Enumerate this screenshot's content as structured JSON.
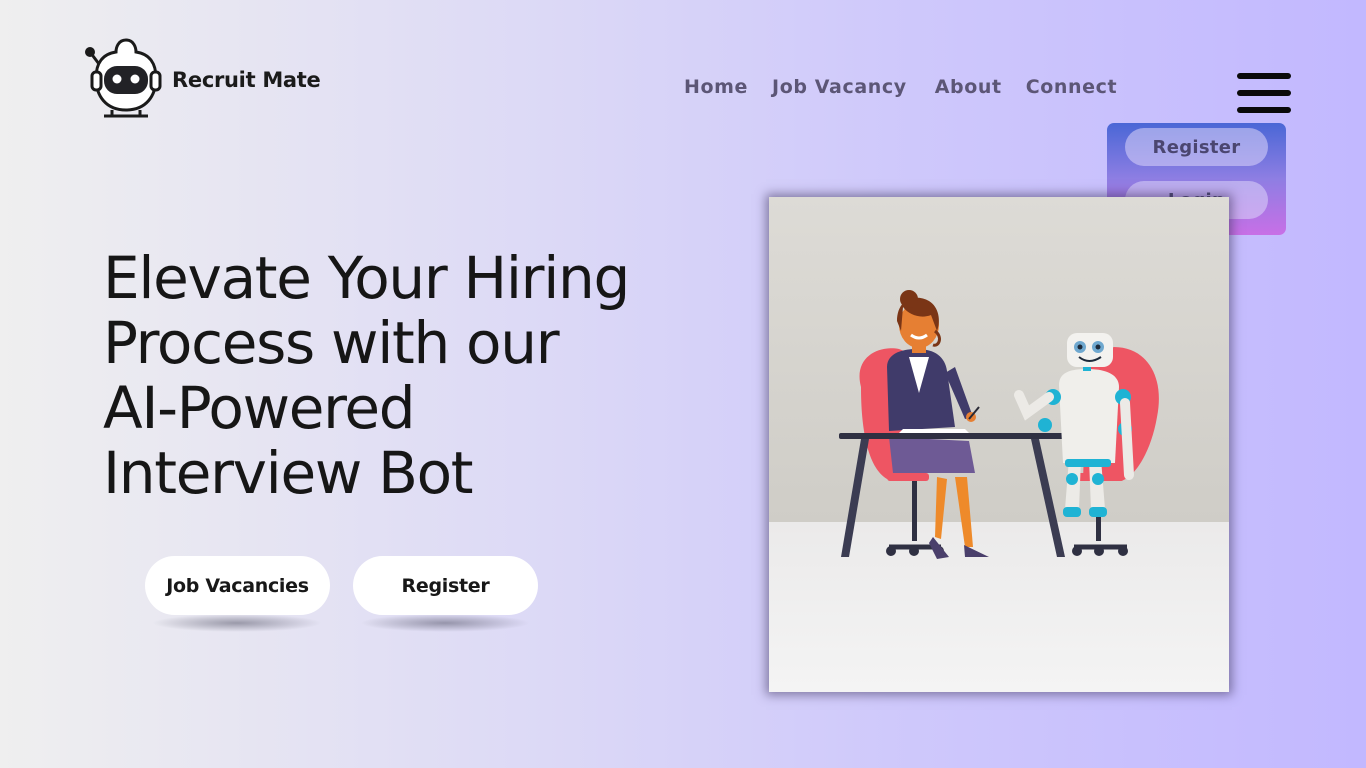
{
  "brand": {
    "name": "Recruit Mate"
  },
  "nav": {
    "items": [
      "Home",
      "Job Vacancy",
      "About",
      "Connect"
    ]
  },
  "menu": {
    "register_label": "Register",
    "login_label": "Login"
  },
  "hero": {
    "title_lines": [
      "Elevate Your Hiring",
      "Process with our",
      "AI-Powered",
      "Interview Bot"
    ],
    "cta_jobs_label": "Job Vacancies",
    "cta_register_label": "Register"
  },
  "colors": {
    "nav_text": "#5c5676",
    "dropdown_top": "#4a67d6",
    "dropdown_bottom": "#c86fe6"
  },
  "icons": {
    "logo": "robot-head-icon",
    "menu": "hamburger-menu-icon"
  }
}
